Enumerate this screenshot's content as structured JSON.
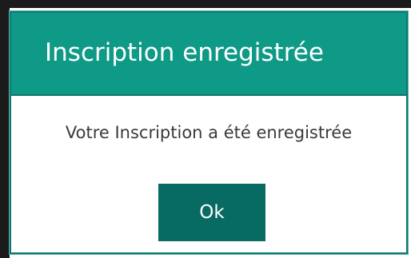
{
  "dialog": {
    "title": "Inscription enregistrée",
    "message": "Votre Inscription a été enregistrée",
    "ok_label": "Ok"
  },
  "colors": {
    "header": "#0e9a86",
    "button": "#076b63",
    "title_text": "#ffffff",
    "message_text": "#3a3a3a"
  }
}
